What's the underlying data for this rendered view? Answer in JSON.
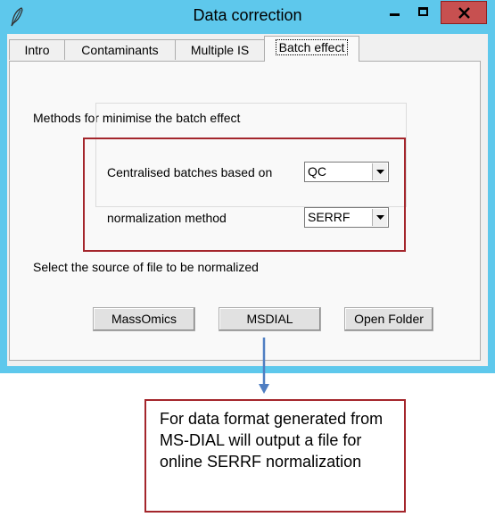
{
  "window": {
    "title": "Data correction",
    "icon": "feather-icon"
  },
  "tabs": [
    {
      "label": "Intro",
      "active": false
    },
    {
      "label": "Contaminants",
      "active": false
    },
    {
      "label": "Multiple IS",
      "active": false
    },
    {
      "label": "Batch effect",
      "active": true
    }
  ],
  "panel": {
    "methods_heading": "Methods for minimise the batch effect",
    "centralised_label": "Centralised batches based on",
    "centralised_value": "QC",
    "normalization_label": "normalization method",
    "normalization_value": "SERRF",
    "source_label": "Select the source of file to be normalized",
    "buttons": {
      "massomics": "MassOmics",
      "msdial": "MSDIAL",
      "open_folder": "Open Folder"
    }
  },
  "annotation": {
    "text": "For data format generated from MS-DIAL will output a file for online SERRF normalization",
    "highlight_color": "#a4262c",
    "arrow_color": "#4f7ec2"
  },
  "colors": {
    "titlebar": "#5ec8ec",
    "close_button": "#c75050"
  }
}
